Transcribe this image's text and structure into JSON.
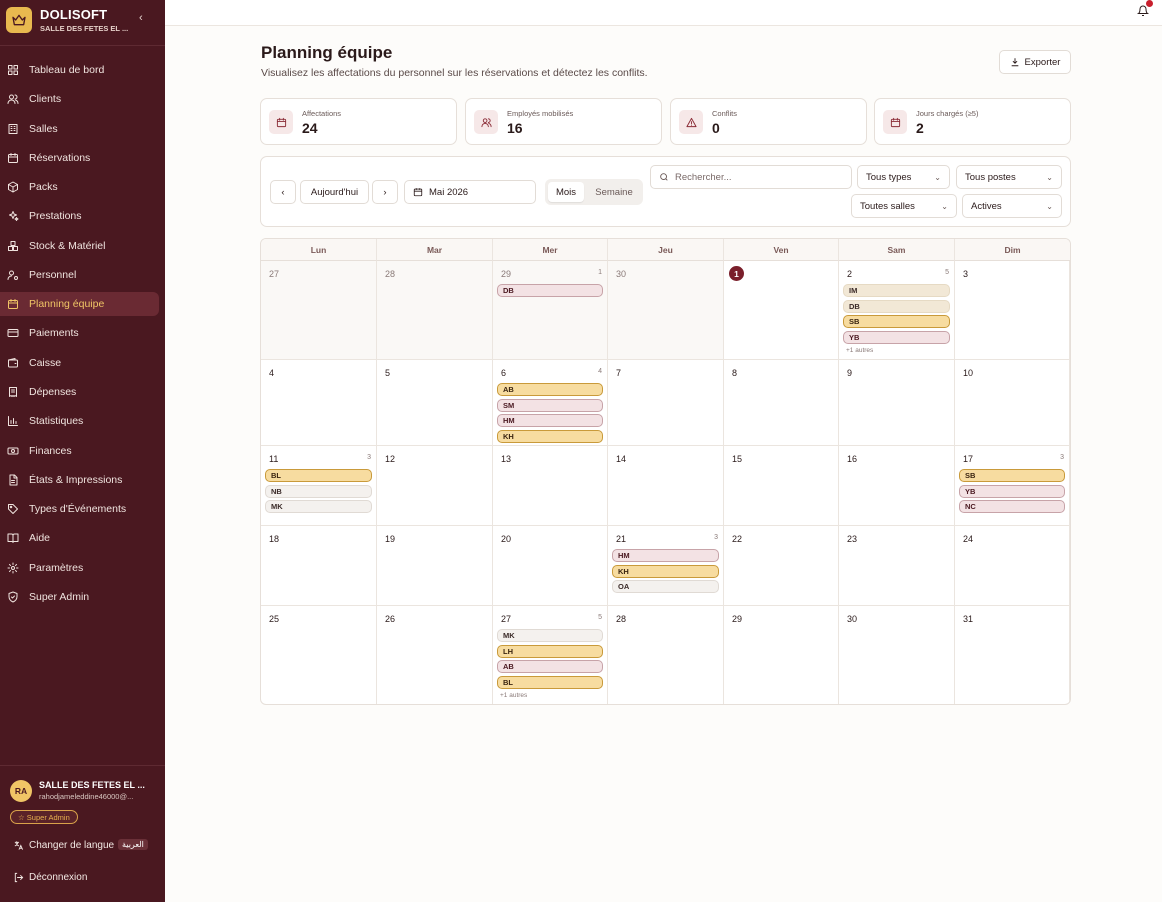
{
  "brand": {
    "name": "DOLISOFT",
    "subtitle": "SALLE DES FETES EL ..."
  },
  "nav": [
    {
      "label": "Tableau de bord",
      "icon": "dashboard-icon"
    },
    {
      "label": "Clients",
      "icon": "users-icon"
    },
    {
      "label": "Salles",
      "icon": "building-icon"
    },
    {
      "label": "Réservations",
      "icon": "calendar-icon"
    },
    {
      "label": "Packs",
      "icon": "package-icon"
    },
    {
      "label": "Prestations",
      "icon": "sparkles-icon"
    },
    {
      "label": "Stock & Matériel",
      "icon": "boxes-icon"
    },
    {
      "label": "Personnel",
      "icon": "user-cog-icon"
    },
    {
      "label": "Planning équipe",
      "icon": "calendar-icon",
      "active": true
    },
    {
      "label": "Paiements",
      "icon": "credit-card-icon"
    },
    {
      "label": "Caisse",
      "icon": "wallet-icon"
    },
    {
      "label": "Dépenses",
      "icon": "receipt-icon"
    },
    {
      "label": "Statistiques",
      "icon": "bar-chart-icon"
    },
    {
      "label": "Finances",
      "icon": "banknote-icon"
    },
    {
      "label": "États & Impressions",
      "icon": "file-text-icon"
    },
    {
      "label": "Types d'Événements",
      "icon": "tag-icon"
    },
    {
      "label": "Aide",
      "icon": "book-icon"
    },
    {
      "label": "Paramètres",
      "icon": "gear-icon"
    },
    {
      "label": "Super Admin",
      "icon": "shield-icon"
    }
  ],
  "footer": {
    "avatar": "RA",
    "org": "SALLE DES FETES EL ...",
    "email": "rahodjameleddine46000@...",
    "badge": "☆ Super Admin",
    "lang_label": "Changer de langue",
    "lang_chip": "العربية",
    "logout": "Déconnexion"
  },
  "notifications": {
    "count": "1"
  },
  "header": {
    "title": "Planning équipe",
    "subtitle": "Visualisez les affectations du personnel sur les réservations et détectez les conflits.",
    "export": "Exporter"
  },
  "stats": [
    {
      "label": "Affectations",
      "value": "24",
      "icon": "calendar-icon"
    },
    {
      "label": "Employés mobilisés",
      "value": "16",
      "icon": "users-icon"
    },
    {
      "label": "Conflits",
      "value": "0",
      "icon": "warning-icon"
    },
    {
      "label": "Jours chargés (≥5)",
      "value": "2",
      "icon": "calendar-icon"
    }
  ],
  "filters": {
    "today": "Aujourd'hui",
    "month": "Mai 2026",
    "view_month": "Mois",
    "view_week": "Semaine",
    "search_placeholder": "Rechercher...",
    "types": "Tous types",
    "posts": "Tous postes",
    "rooms": "Toutes salles",
    "status": "Actives"
  },
  "calendar": {
    "weekdays": [
      "Lun",
      "Mar",
      "Mer",
      "Jeu",
      "Ven",
      "Sam",
      "Dim"
    ],
    "weeks": [
      [
        {
          "day": "27",
          "muted": true,
          "count": "",
          "chips": []
        },
        {
          "day": "28",
          "muted": true,
          "count": "",
          "chips": []
        },
        {
          "day": "29",
          "muted": true,
          "count": "1",
          "chips": [
            {
              "t": "DB",
              "c": "rose"
            }
          ]
        },
        {
          "day": "30",
          "muted": true,
          "count": "",
          "chips": []
        },
        {
          "day": "1",
          "today": true,
          "count": "",
          "chips": []
        },
        {
          "day": "2",
          "count": "5",
          "chips": [
            {
              "t": "IM",
              "c": "beige"
            },
            {
              "t": "DB",
              "c": "beige"
            },
            {
              "t": "SB",
              "c": "gold"
            },
            {
              "t": "YB",
              "c": "rose"
            }
          ],
          "more": "+1 autres"
        },
        {
          "day": "3",
          "count": "",
          "chips": []
        }
      ],
      [
        {
          "day": "4",
          "count": "",
          "chips": []
        },
        {
          "day": "5",
          "count": "",
          "chips": []
        },
        {
          "day": "6",
          "count": "4",
          "chips": [
            {
              "t": "AB",
              "c": "gold"
            },
            {
              "t": "SM",
              "c": "rose"
            },
            {
              "t": "HM",
              "c": "rose"
            },
            {
              "t": "KH",
              "c": "gold"
            }
          ]
        },
        {
          "day": "7",
          "count": "",
          "chips": []
        },
        {
          "day": "8",
          "count": "",
          "chips": []
        },
        {
          "day": "9",
          "count": "",
          "chips": []
        },
        {
          "day": "10",
          "count": "",
          "chips": []
        }
      ],
      [
        {
          "day": "11",
          "count": "3",
          "chips": [
            {
              "t": "BL",
              "c": "gold"
            },
            {
              "t": "NB",
              "c": "grey"
            },
            {
              "t": "MK",
              "c": "grey"
            }
          ]
        },
        {
          "day": "12",
          "count": "",
          "chips": []
        },
        {
          "day": "13",
          "count": "",
          "chips": []
        },
        {
          "day": "14",
          "count": "",
          "chips": []
        },
        {
          "day": "15",
          "count": "",
          "chips": []
        },
        {
          "day": "16",
          "count": "",
          "chips": []
        },
        {
          "day": "17",
          "count": "3",
          "chips": [
            {
              "t": "SB",
              "c": "gold"
            },
            {
              "t": "YB",
              "c": "rose"
            },
            {
              "t": "NC",
              "c": "rose"
            }
          ]
        }
      ],
      [
        {
          "day": "18",
          "count": "",
          "chips": []
        },
        {
          "day": "19",
          "count": "",
          "chips": []
        },
        {
          "day": "20",
          "count": "",
          "chips": []
        },
        {
          "day": "21",
          "count": "3",
          "chips": [
            {
              "t": "HM",
              "c": "rose"
            },
            {
              "t": "KH",
              "c": "gold"
            },
            {
              "t": "OA",
              "c": "grey"
            }
          ]
        },
        {
          "day": "22",
          "count": "",
          "chips": []
        },
        {
          "day": "23",
          "count": "",
          "chips": []
        },
        {
          "day": "24",
          "count": "",
          "chips": []
        }
      ],
      [
        {
          "day": "25",
          "count": "",
          "chips": []
        },
        {
          "day": "26",
          "count": "",
          "chips": []
        },
        {
          "day": "27",
          "count": "5",
          "chips": [
            {
              "t": "MK",
              "c": "grey"
            },
            {
              "t": "LH",
              "c": "gold"
            },
            {
              "t": "AB",
              "c": "rose"
            },
            {
              "t": "BL",
              "c": "gold"
            }
          ],
          "more": "+1 autres"
        },
        {
          "day": "28",
          "count": "",
          "chips": []
        },
        {
          "day": "29",
          "count": "",
          "chips": []
        },
        {
          "day": "30",
          "count": "",
          "chips": []
        },
        {
          "day": "31",
          "count": "",
          "chips": []
        }
      ]
    ]
  }
}
